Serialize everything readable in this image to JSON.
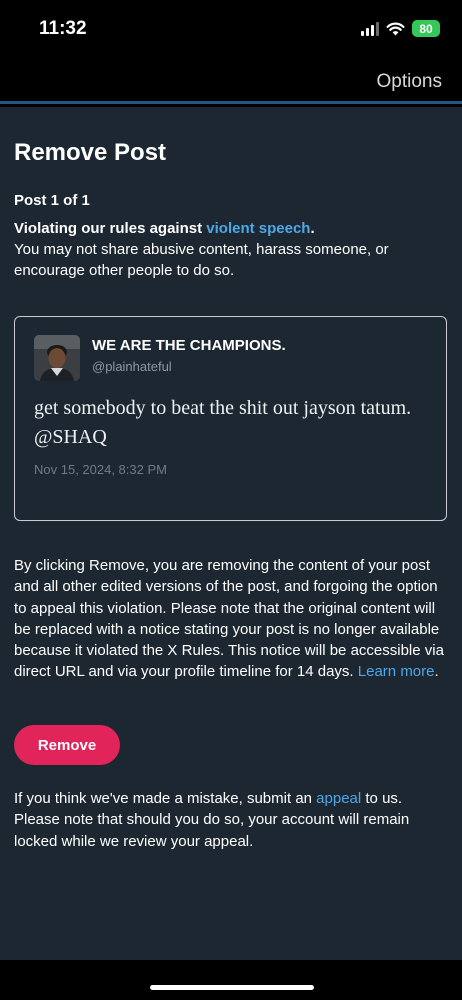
{
  "status_bar": {
    "time": "11:32",
    "battery": "80",
    "icons": [
      "signal-icon",
      "wifi-icon",
      "battery-icon"
    ],
    "battery_color": "#34c759"
  },
  "nav": {
    "options_label": "Options"
  },
  "page": {
    "title": "Remove Post",
    "post_count": "Post 1 of 1",
    "rule_prefix": "Violating our rules against ",
    "rule_link": "violent speech",
    "rule_suffix": ".",
    "rule_description": "You may not share abusive content, harass someone, or encourage other people to do so."
  },
  "post": {
    "author_name": "WE ARE THE CHAMPIONS.",
    "author_handle": "@plainhateful",
    "text": "get somebody to beat the shit out jayson tatum. @SHAQ",
    "date": "Nov 15, 2024, 8:32 PM"
  },
  "notice": {
    "text": "By clicking Remove, you are removing the content of your post and all other edited versions of the post, and forgoing the option to appeal this violation. Please note that the original content will be replaced with a notice stating your post is no longer available because it violated the X Rules. This notice will be accessible via direct URL and via your profile timeline for 14 days. ",
    "learn_more": "Learn more",
    "end": "."
  },
  "actions": {
    "remove_label": "Remove",
    "remove_color": "#e1245a"
  },
  "appeal": {
    "prefix": "If you think we've made a mistake, submit an ",
    "link": "appeal",
    "suffix": " to us. Please note that should you do so, your account will remain locked while we review your appeal."
  },
  "colors": {
    "background": "#1d2732",
    "link": "#4ea7e6",
    "accent_line": "#1d5a86"
  }
}
